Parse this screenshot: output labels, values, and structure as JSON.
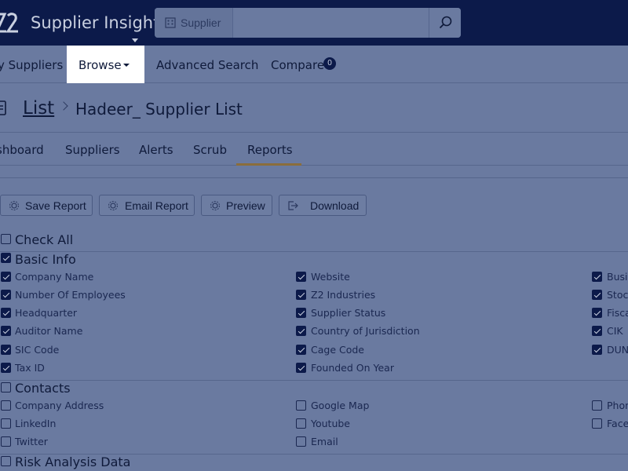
{
  "header": {
    "app_title": "Supplier Insight",
    "search": {
      "scope_label": "Supplier",
      "placeholder": ""
    }
  },
  "nav": {
    "items": [
      "y Suppliers",
      "Browse",
      "Advanced Search",
      "Compare"
    ],
    "compare_count": "0"
  },
  "breadcrumb": {
    "link": "List",
    "current": "Hadeer_ Supplier List"
  },
  "tabs": {
    "items": [
      "shboard",
      "Suppliers",
      "Alerts",
      "Scrub",
      "Reports"
    ],
    "active": "Reports"
  },
  "actions": [
    "Save Report",
    "Email Report",
    "Preview",
    "Download"
  ],
  "check_all": {
    "label": "Check All",
    "checked": false
  },
  "groups": [
    {
      "title": "Basic Info",
      "checked": true,
      "items": [
        {
          "label": "Company Name",
          "checked": true
        },
        {
          "label": "Website",
          "checked": true
        },
        {
          "label": "Busin",
          "checked": true
        },
        {
          "label": "Number Of Employees",
          "checked": true
        },
        {
          "label": "Z2 Industries",
          "checked": true
        },
        {
          "label": "Stock",
          "checked": true
        },
        {
          "label": "Headquarter",
          "checked": true
        },
        {
          "label": "Supplier Status",
          "checked": true
        },
        {
          "label": "Fisca",
          "checked": true
        },
        {
          "label": "Auditor Name",
          "checked": true
        },
        {
          "label": "Country of Jurisdiction",
          "checked": true
        },
        {
          "label": "CIK",
          "checked": true
        },
        {
          "label": "SIC Code",
          "checked": true
        },
        {
          "label": "Cage Code",
          "checked": true
        },
        {
          "label": "DUNS",
          "checked": true
        },
        {
          "label": "Tax ID",
          "checked": true
        },
        {
          "label": "Founded On Year",
          "checked": true
        }
      ]
    },
    {
      "title": "Contacts",
      "checked": false,
      "items": [
        {
          "label": "Company Address",
          "checked": false
        },
        {
          "label": "Google Map",
          "checked": false
        },
        {
          "label": "Phon",
          "checked": false
        },
        {
          "label": "LinkedIn",
          "checked": false
        },
        {
          "label": "Youtube",
          "checked": false
        },
        {
          "label": "Face",
          "checked": false
        },
        {
          "label": "Twitter",
          "checked": false
        },
        {
          "label": "Email",
          "checked": false
        }
      ]
    },
    {
      "title": "Risk Analysis Data",
      "checked": false,
      "items": []
    }
  ]
}
